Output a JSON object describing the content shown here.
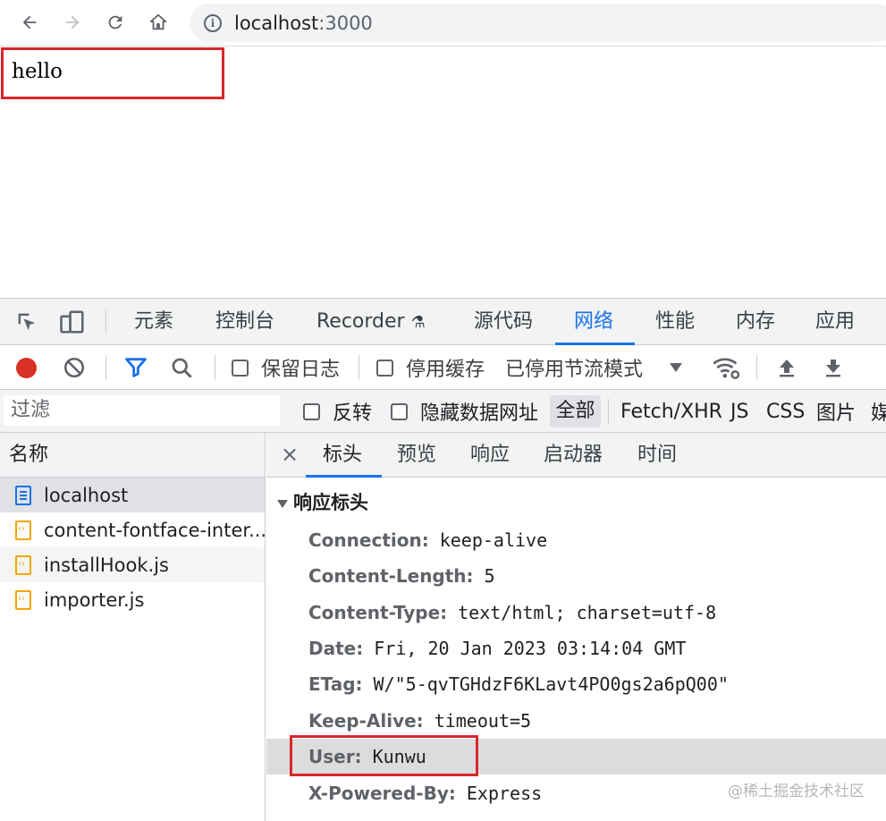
{
  "browser": {
    "url_host": "localhost",
    "url_port": ":3000",
    "icons": [
      "back-icon",
      "forward-icon",
      "reload-icon",
      "home-icon",
      "info-icon"
    ]
  },
  "page": {
    "text": "hello"
  },
  "devtools": {
    "tabs": [
      "元素",
      "控制台",
      "Recorder",
      "源代码",
      "网络",
      "性能",
      "内存",
      "应用"
    ],
    "active_tab": "网络",
    "toolbar": {
      "preserve_log": "保留日志",
      "disable_cache": "停用缓存",
      "throttling": "已停用节流模式"
    },
    "filter": {
      "placeholder": "过滤",
      "invert": "反转",
      "hide_data_urls": "隐藏数据网址",
      "types": [
        "全部",
        "Fetch/XHR",
        "JS",
        "CSS",
        "图片",
        "媒"
      ]
    },
    "requests": {
      "header": "名称",
      "items": [
        "localhost",
        "content-fontface-inter...",
        "installHook.js",
        "importer.js"
      ]
    },
    "detail": {
      "tabs": [
        "标头",
        "预览",
        "响应",
        "启动器",
        "时间"
      ],
      "section_title": "响应标头",
      "headers": [
        {
          "name": "Connection:",
          "value": "keep-alive"
        },
        {
          "name": "Content-Length:",
          "value": "5"
        },
        {
          "name": "Content-Type:",
          "value": "text/html; charset=utf-8"
        },
        {
          "name": "Date:",
          "value": "Fri, 20 Jan 2023 03:14:04 GMT"
        },
        {
          "name": "ETag:",
          "value": "W/\"5-qvTGHdzF6KLavt4PO0gs2a6pQ00\""
        },
        {
          "name": "Keep-Alive:",
          "value": "timeout=5"
        },
        {
          "name": "User:",
          "value": "Kunwu"
        },
        {
          "name": "X-Powered-By:",
          "value": "Express"
        }
      ]
    }
  },
  "watermark": "@稀土掘金技术社区",
  "colors": {
    "accent": "#1a73e8",
    "highlight_box": "#d9262c",
    "record": "#d93025"
  }
}
